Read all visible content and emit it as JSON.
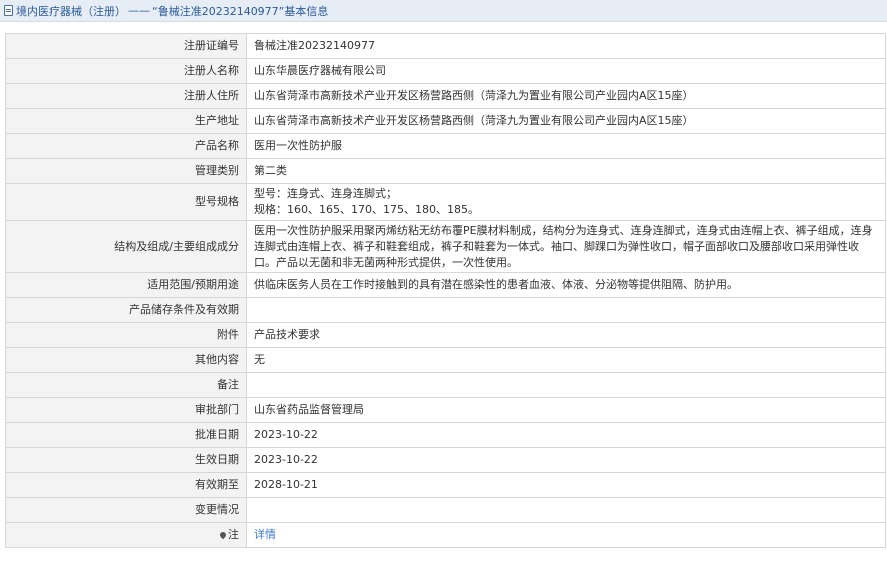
{
  "header": {
    "breadcrumb_link": "境内医疗器械（注册）",
    "separator": "——",
    "title": "“鲁械注准20232140977”基本信息"
  },
  "rows": [
    {
      "label": "注册证编号",
      "value": "鲁械注准20232140977"
    },
    {
      "label": "注册人名称",
      "value": "山东华晨医疗器械有限公司"
    },
    {
      "label": "注册人住所",
      "value": "山东省菏泽市高新技术产业开发区杨营路西侧（菏泽九为置业有限公司产业园内A区15座）"
    },
    {
      "label": "生产地址",
      "value": "山东省菏泽市高新技术产业开发区杨营路西侧（菏泽九为置业有限公司产业园内A区15座）"
    },
    {
      "label": "产品名称",
      "value": "医用一次性防护服"
    },
    {
      "label": "管理类别",
      "value": "第二类"
    },
    {
      "label": "型号规格",
      "value_line1": "型号：连身式、连身连脚式；",
      "value_line2": "规格：160、165、170、175、180、185。"
    },
    {
      "label": "结构及组成/主要组成成分",
      "value": "医用一次性防护服采用聚丙烯纺粘无纺布覆PE膜材料制成，结构分为连身式、连身连脚式，连身式由连帽上衣、裤子组成，连身连脚式由连帽上衣、裤子和鞋套组成，裤子和鞋套为一体式。袖口、脚踝口为弹性收口，帽子面部收口及腰部收口采用弹性收口。产品以无菌和非无菌两种形式提供，一次性使用。"
    },
    {
      "label": "适用范围/预期用途",
      "value": "供临床医务人员在工作时接触到的具有潜在感染性的患者血液、体液、分泌物等提供阻隔、防护用。"
    },
    {
      "label": "产品储存条件及有效期",
      "value": ""
    },
    {
      "label": "附件",
      "value": "产品技术要求"
    },
    {
      "label": "其他内容",
      "value": "无"
    },
    {
      "label": "备注",
      "value": ""
    },
    {
      "label": "审批部门",
      "value": "山东省药品监督管理局"
    },
    {
      "label": "批准日期",
      "value": "2023-10-22"
    },
    {
      "label": "生效日期",
      "value": "2023-10-22"
    },
    {
      "label": "有效期至",
      "value": "2028-10-21"
    },
    {
      "label": "变更情况",
      "value": ""
    },
    {
      "label": "注",
      "value": "详情"
    }
  ]
}
